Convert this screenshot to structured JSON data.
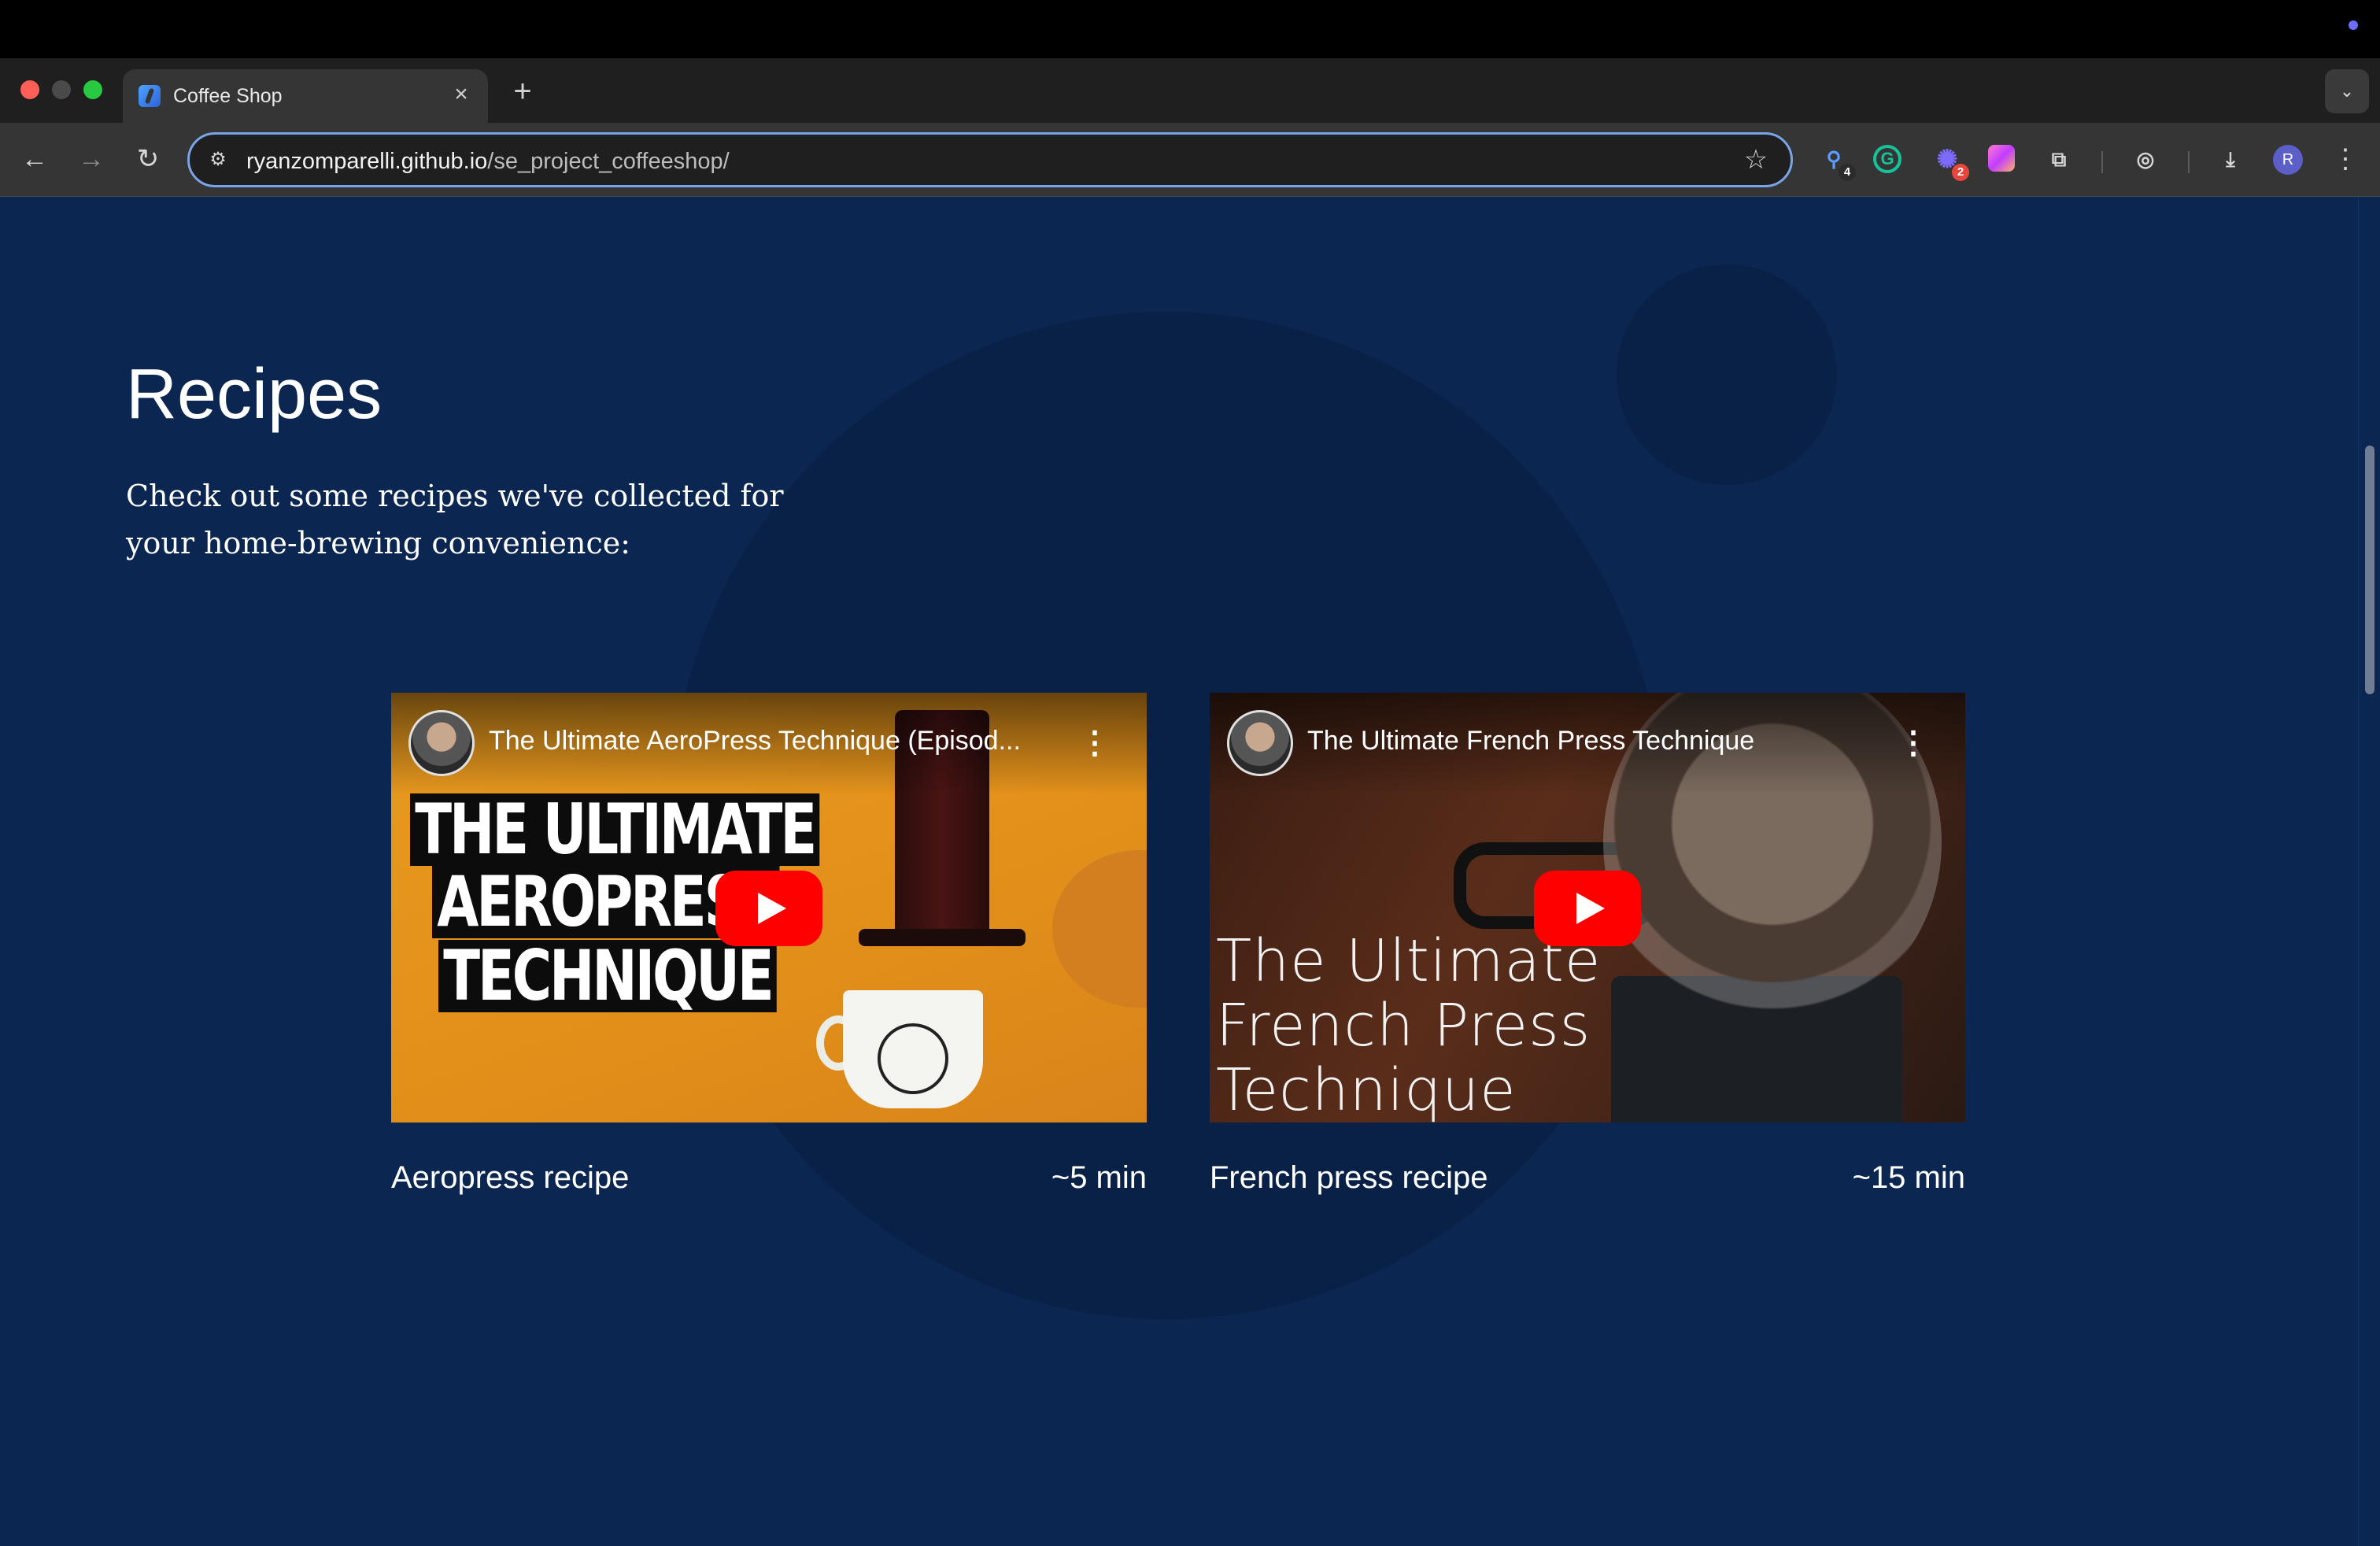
{
  "browser": {
    "tab_title": "Coffee Shop",
    "tab_close": "×",
    "new_tab": "+",
    "url_host": "ryanzomparelli.github.io",
    "url_path": "/se_project_coffeeshop/",
    "extensions": [
      {
        "name": "extension-1",
        "badge": "4"
      },
      {
        "name": "grammarly",
        "glyph": "G"
      },
      {
        "name": "extension-3",
        "badge": "2"
      },
      {
        "name": "extension-4"
      },
      {
        "name": "extensions-puzzle"
      }
    ],
    "profile_initial": "R"
  },
  "page": {
    "heading": "Recipes",
    "subtitle": "Check out some recipes we've collected for your home-brewing convenience:",
    "background_color": "#0b2650"
  },
  "recipes": [
    {
      "video_title": "The Ultimate AeroPress Technique (Episod...",
      "thumb_lines": [
        "THE ULTIMATE",
        "AEROPRESS",
        "TECHNIQUE"
      ],
      "name": "Aeropress recipe",
      "time": "~5 min"
    },
    {
      "video_title": "The Ultimate French Press Technique",
      "thumb_lines": [
        "The Ultimate",
        "French Press",
        "Technique"
      ],
      "name": "French press recipe",
      "time": "~15 min"
    }
  ],
  "colors": {
    "youtube_red": "#ff0000",
    "accent_blue": "#7ba3e8"
  }
}
